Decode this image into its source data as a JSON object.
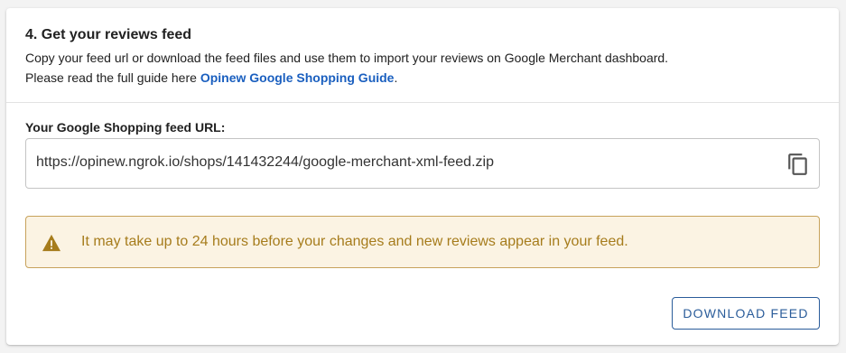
{
  "section": {
    "title": "4. Get your reviews feed",
    "description_line1": "Copy your feed url or download the feed files and use them to import your reviews on Google Merchant dashboard.",
    "description_line2_prefix": "Please read the full guide here ",
    "guide_link_label": "Opinew Google Shopping Guide",
    "description_line2_suffix": "."
  },
  "feed_url": {
    "label": "Your Google Shopping feed URL:",
    "value": "https://opinew.ngrok.io/shops/141432244/google-merchant-xml-feed.zip",
    "copy_icon": "copy-icon"
  },
  "alert": {
    "icon": "warning-icon",
    "message": "It may take up to 24 hours before your changes and new reviews appear in your feed.",
    "background": "#fbf3e3",
    "border": "#c7a25b",
    "text_color": "#a67c1c"
  },
  "actions": {
    "download_label": "Download feed"
  },
  "colors": {
    "link": "#1a5fbf",
    "primary_button": "#2a5c9a"
  }
}
